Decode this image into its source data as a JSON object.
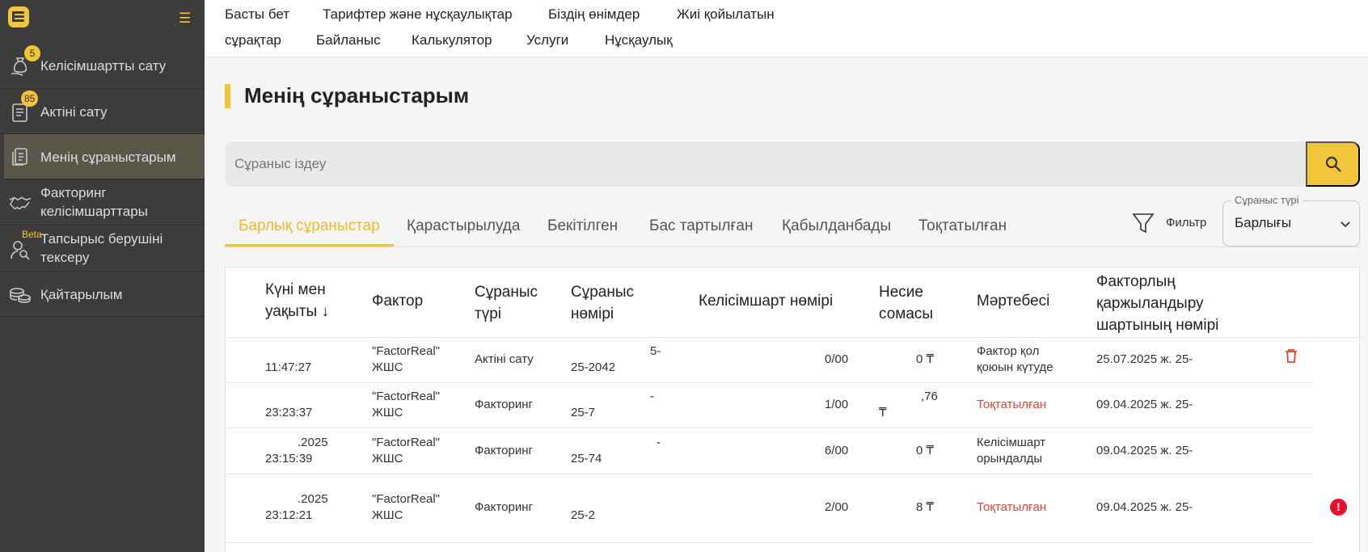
{
  "sidebar": {
    "items": [
      {
        "label": "Келісімшартты сату",
        "badge": "5",
        "icon": "money-bag-icon"
      },
      {
        "label": "Актіні сату",
        "badge": "85",
        "icon": "document-list-icon"
      },
      {
        "label": "Менің сұраныстарым",
        "icon": "documents-icon",
        "active": true
      },
      {
        "label": "Факторинг келісімшарттары",
        "icon": "handshake-icon"
      },
      {
        "label": "Тапсырыс берушіні тексеру",
        "tag": "Beta",
        "icon": "user-search-icon"
      },
      {
        "label": "Қайтарылым",
        "icon": "coins-icon"
      }
    ]
  },
  "nav": {
    "links": [
      "Басты бет",
      "Тарифтер және нұсқаулықтар",
      "Біздің өнімдер",
      "Жиі қойылатын",
      "сұрақтар",
      "Байланыс",
      "Калькулятор",
      "Услуги",
      "Нұсқаулық"
    ]
  },
  "page": {
    "title": "Менің сұраныстарым"
  },
  "search": {
    "placeholder": "Сұраныс іздеу"
  },
  "tabs": [
    "Барлық сұраныстар",
    "Қарастырылуда",
    "Бекітілген",
    "Бас тартылған",
    "Қабылданбады",
    "Тоқтатылған"
  ],
  "filter": {
    "label": "Фильтр",
    "select_legend": "Сұраныс түрі",
    "select_value": "Барлығы"
  },
  "table": {
    "headers": [
      [
        "Күні мен",
        "уақыты ↓"
      ],
      [
        "Фактор"
      ],
      [
        "Сұраныс",
        "түрі"
      ],
      [
        "Сұраныс",
        "нөмірі"
      ],
      [
        "Келісімшарт нөмірі"
      ],
      [
        "Несие",
        "сомасы"
      ],
      [
        "Мәртебесі"
      ],
      [
        "Факторлың",
        "қаржыландыру",
        "шартының нөмірі"
      ]
    ],
    "rows": [
      {
        "date": "",
        "time": "11:47:27",
        "factor1": "\"FactorReal\"",
        "factor2": "ЖШС",
        "type": "Актіні сату",
        "req_a": "5-",
        "req_b": "25-2042",
        "contract": "0/00",
        "amount": "0 ₸",
        "amount2": "",
        "status1": "Фактор қол",
        "status2": "қоюын күтуде",
        "status_red": false,
        "fin": "25.07.2025 ж. 25-"
      },
      {
        "date": "",
        "time": "23:23:37",
        "factor1": "\"FactorReal\"",
        "factor2": "ЖШС",
        "type": "Факторинг",
        "req_a": "-",
        "req_b": "25-7",
        "contract": "1/00",
        "amount": ",76",
        "amount2": "₸",
        "status1": "Тоқтатылған",
        "status2": "",
        "status_red": true,
        "fin": "09.04.2025 ж. 25-"
      },
      {
        "date": ".2025",
        "time": "23:15:39",
        "factor1": "\"FactorReal\"",
        "factor2": "ЖШС",
        "type": "Факторинг",
        "req_a": "-",
        "req_b": "25-74",
        "contract": "6/00",
        "amount": "0 ₸",
        "amount2": "",
        "status1": "Келісімшарт",
        "status2": "орындалды",
        "status_red": false,
        "fin": "09.04.2025 ж. 25-"
      },
      {
        "date": ".2025",
        "time": "23:12:21",
        "factor1": "\"FactorReal\"",
        "factor2": "ЖШС",
        "type": "Факторинг",
        "req_a": "",
        "req_b": "25-2",
        "contract": "2/00",
        "amount": "8 ₸",
        "amount2": "",
        "status1": "Тоқтатылған",
        "status2": "",
        "status_red": true,
        "fin": "09.04.2025 ж. 25-"
      }
    ]
  },
  "colors": {
    "accent": "#f0c53a",
    "sidebar": "#3c3c3c",
    "danger": "#e2452f"
  }
}
